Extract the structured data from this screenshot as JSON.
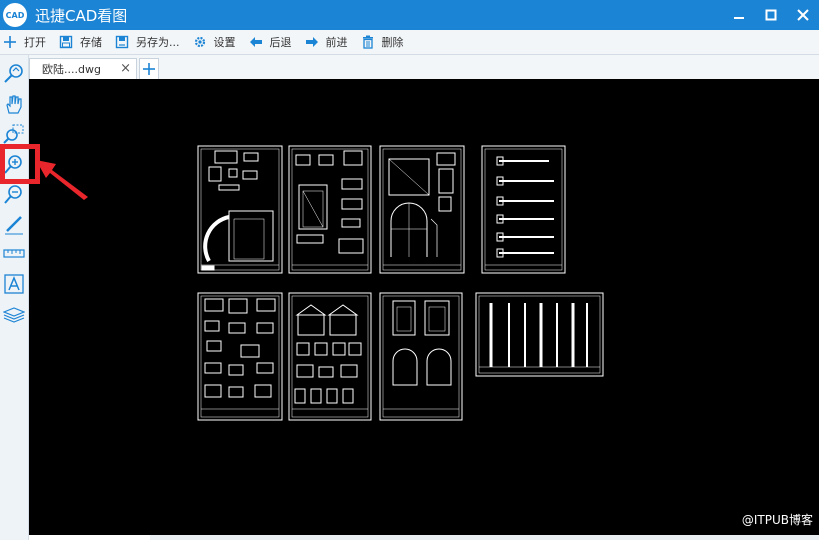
{
  "window": {
    "logo_text": "CAD",
    "title": "迅捷CAD看图",
    "controls": [
      "minimize",
      "maximize",
      "close"
    ]
  },
  "toolbar": {
    "open_label": "打开",
    "save_label": "存储",
    "save_as_label": "另存为...",
    "settings_label": "设置",
    "back_label": "后退",
    "forward_label": "前进",
    "delete_label": "删除"
  },
  "tabs": [
    {
      "label": "欧陆....dwg",
      "close": "×",
      "active": true
    }
  ],
  "sidebar": {
    "tools": [
      "zoom-extents-icon",
      "pan-hand-icon",
      "zoom-window-icon",
      "zoom-in-icon",
      "zoom-out-icon",
      "pen-icon",
      "measure-icon",
      "text-icon",
      "layers-icon"
    ],
    "highlighted_tool": "zoom-in-icon"
  },
  "canvas": {
    "background": "#000000",
    "drawing_sheets": 8
  },
  "colors": {
    "titlebar": "#1c84d4",
    "accent_icon": "#1c84d4",
    "annotation": "#e8262b"
  },
  "watermark": "@ITPUB博客"
}
